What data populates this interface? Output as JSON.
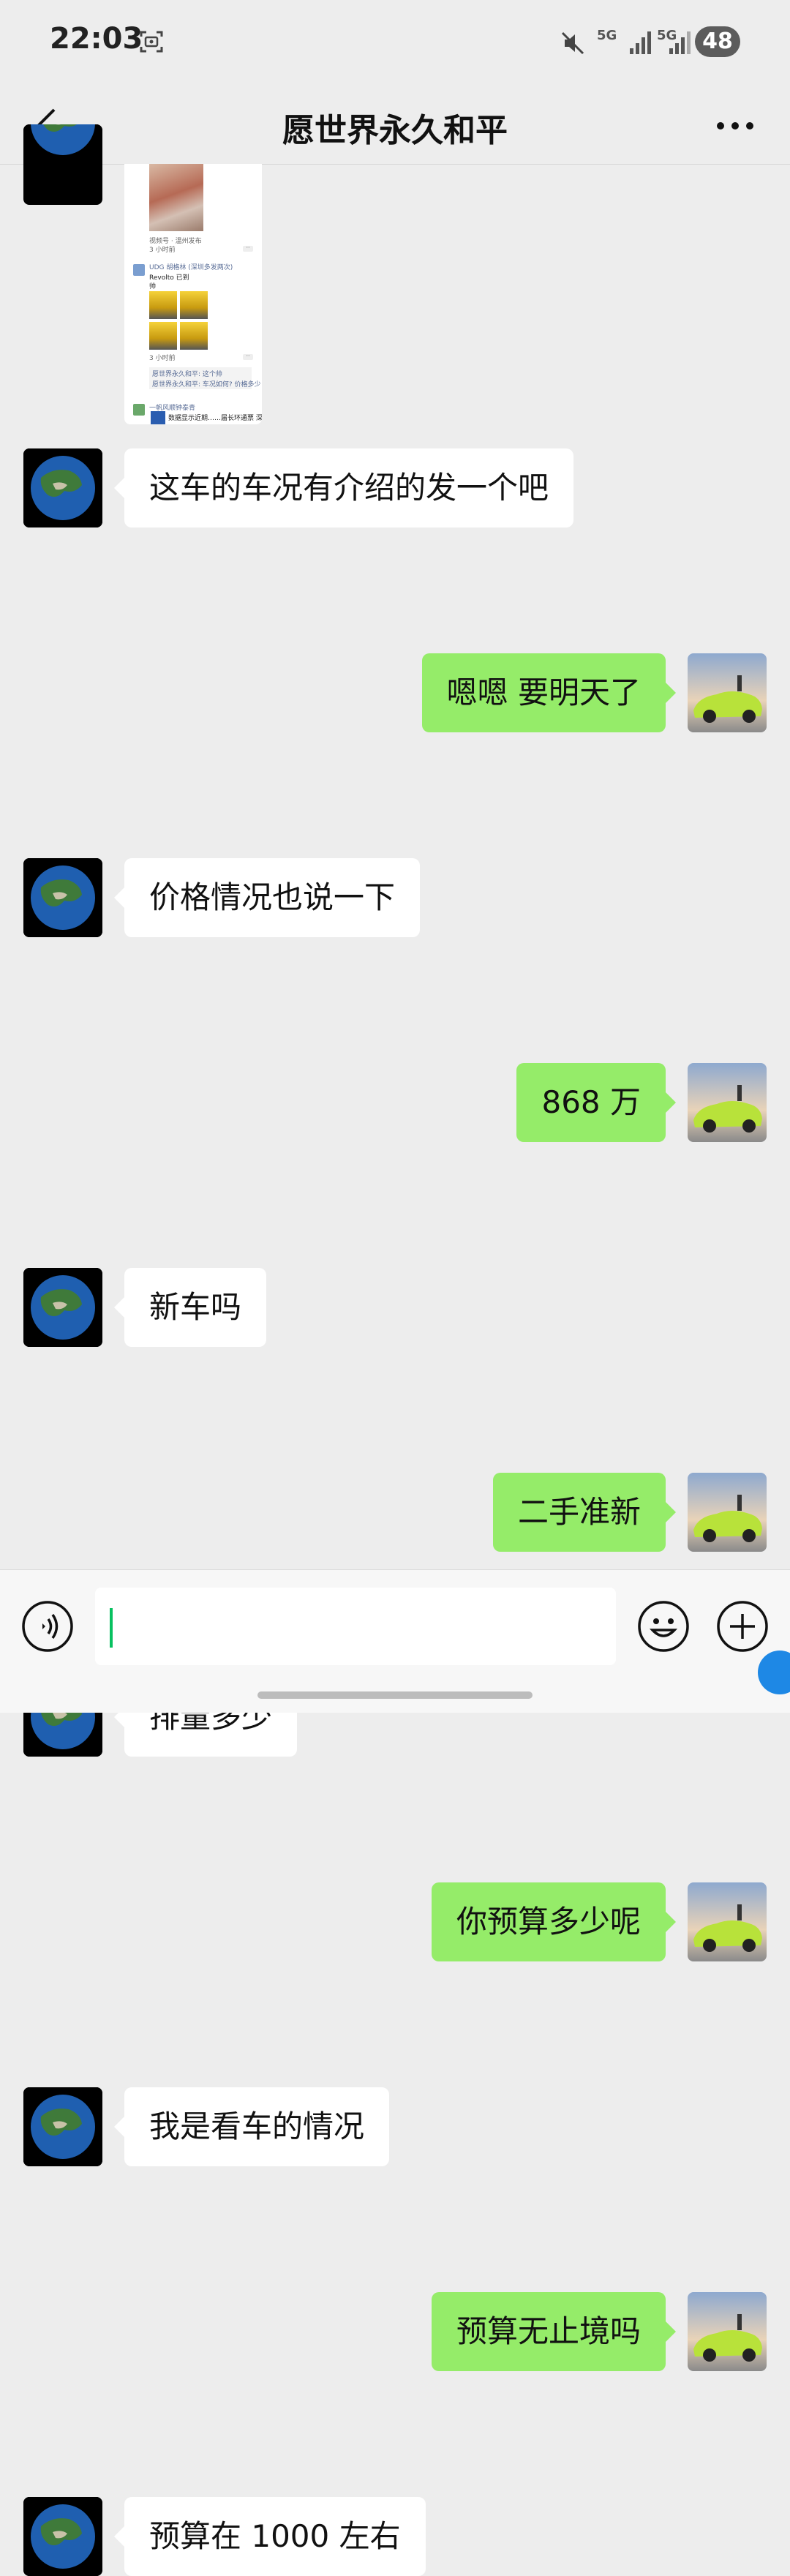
{
  "status_bar": {
    "time": "22:03",
    "network_1": "5G",
    "network_2": "5G",
    "battery": "48",
    "icons": [
      "screen-record-icon",
      "mute-icon",
      "signal-icon",
      "signal-icon",
      "battery-icon"
    ]
  },
  "header": {
    "title": "愿世界永久和平",
    "back_icon": "chevron-left-icon",
    "more_icon": "more-dots-icon"
  },
  "forwarded_card": {
    "caption_1": "视频号 · 温州发布",
    "time_1": "3 小时前",
    "author": "UDG 胡格林 (深圳多发两次)",
    "text_1": "Revolto 已到",
    "text_2": "帅",
    "time_2": "3 小时前",
    "comment_1": "愿世界永久和平: 这个帅",
    "comment_2": "愿世界永久和平: 车况如何? 价格多少",
    "author_2": "一帆风顺钟泰青",
    "text_3": "数据显示近期……届长环通票 深"
  },
  "messages": [
    {
      "side": "left",
      "text": "这车的车况有介绍的发一个吧"
    },
    {
      "side": "right",
      "text": "嗯嗯 要明天了"
    },
    {
      "side": "left",
      "text": "价格情况也说一下"
    },
    {
      "side": "right",
      "text": "868 万"
    },
    {
      "side": "left",
      "text": "新车吗"
    },
    {
      "side": "right",
      "text": "二手准新"
    },
    {
      "side": "left",
      "text": "排量多少"
    },
    {
      "side": "right",
      "text": "你预算多少呢"
    },
    {
      "side": "left",
      "text": "我是看车的情况"
    },
    {
      "side": "right",
      "text": "预算无止境吗"
    },
    {
      "side": "left",
      "text": "预算在 1000 左右"
    }
  ],
  "input_bar": {
    "value": "",
    "voice_icon": "voice-icon",
    "emoji_icon": "emoji-icon",
    "plus_icon": "plus-icon"
  },
  "colors": {
    "background": "#ededed",
    "sent_bubble": "#95ec69",
    "received_bubble": "#ffffff",
    "caret": "#07c160"
  }
}
